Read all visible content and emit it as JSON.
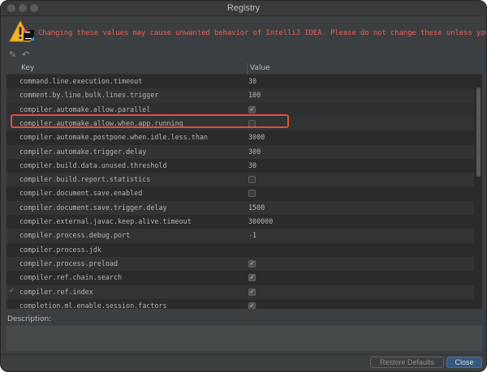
{
  "window": {
    "title": "Registry"
  },
  "warning_text": "Changing these values may cause unwanted behavior of IntelliJ IDEA. Please do not change these unless you have been asked.",
  "toolbar": {
    "edit_icon": "pencil-icon",
    "revert_icon": "undo-icon"
  },
  "table": {
    "headers": {
      "key": "Key",
      "value": "Value"
    },
    "rows": [
      {
        "key": "command.line.execution.timeout",
        "value": "30",
        "type": "text"
      },
      {
        "key": "comment.by.line.bulk.lines.trigger",
        "value": "100",
        "type": "text"
      },
      {
        "key": "compiler.automake.allow.parallel",
        "value": "true",
        "type": "checkbox"
      },
      {
        "key": "compiler.automake.allow.when.app.running",
        "value": "false",
        "type": "checkbox"
      },
      {
        "key": "compiler.automake.postpone.when.idle.less.than",
        "value": "3000",
        "type": "text"
      },
      {
        "key": "compiler.automake.trigger.delay",
        "value": "300",
        "type": "text"
      },
      {
        "key": "compiler.build.data.unused.threshold",
        "value": "30",
        "type": "text"
      },
      {
        "key": "compiler.build.report.statistics",
        "value": "false",
        "type": "checkbox"
      },
      {
        "key": "compiler.document.save.enabled",
        "value": "false",
        "type": "checkbox"
      },
      {
        "key": "compiler.document.save.trigger.delay",
        "value": "1500",
        "type": "text"
      },
      {
        "key": "compiler.external.javac.keep.alive.timeout",
        "value": "300000",
        "type": "text"
      },
      {
        "key": "compiler.process.debug.port",
        "value": "-1",
        "type": "text"
      },
      {
        "key": "compiler.process.jdk",
        "value": "",
        "type": "text"
      },
      {
        "key": "compiler.process.preload",
        "value": "true",
        "type": "checkbox"
      },
      {
        "key": "compiler.ref.chain.search",
        "value": "true",
        "type": "checkbox"
      },
      {
        "key": "compiler.ref.index",
        "value": "true",
        "type": "checkbox",
        "modified_mark": "✓"
      },
      {
        "key": "completion.ml.enable.session.factors",
        "value": "true",
        "type": "checkbox"
      }
    ]
  },
  "description": {
    "label": "Description:"
  },
  "buttons": {
    "restore": "Restore Defaults",
    "close": "Close"
  },
  "colors": {
    "warning": "#f25b59",
    "highlight_border": "#e0533a",
    "primary_button": "#365880"
  }
}
